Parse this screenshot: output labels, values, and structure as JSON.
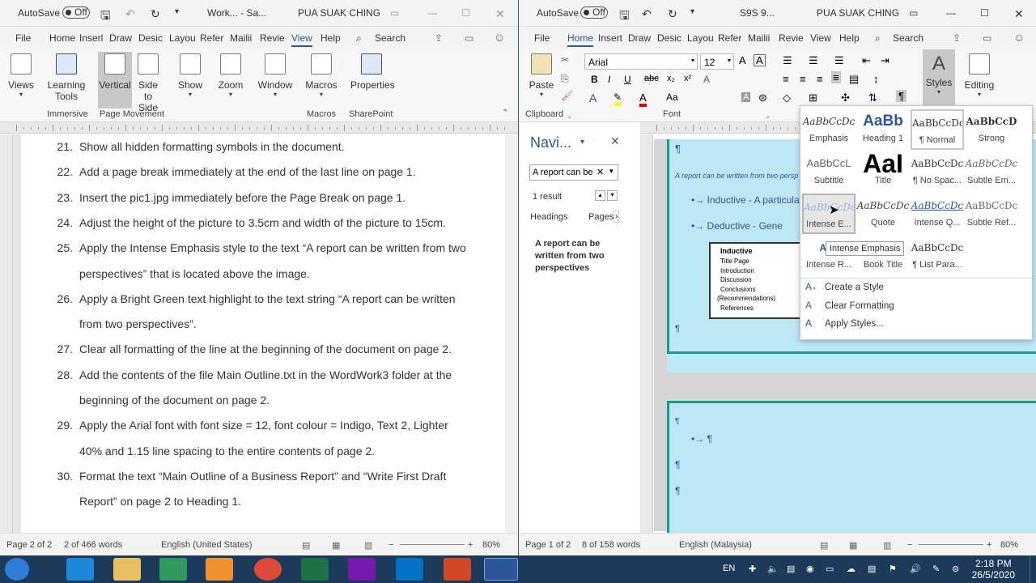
{
  "left": {
    "autosave_label": "AutoSave",
    "autosave_state": "Off",
    "doc_title": "Work... - Sa...",
    "user": "PUA SUAK CHING",
    "tabs": [
      "File",
      "Home",
      "Insert",
      "Draw",
      "Design",
      "Layout",
      "References",
      "Mailings",
      "Review",
      "View",
      "Help"
    ],
    "tabs_short": [
      "File",
      "Home",
      "Inserl",
      "Draw",
      "Desic",
      "Layou",
      "Refer",
      "Mailii",
      "Revie",
      "View",
      "Help"
    ],
    "active_tab": "View",
    "search_label": "Search",
    "ribbon": {
      "views": "Views",
      "learning_tools": "Learning Tools",
      "vertical": "Vertical",
      "side_to_side": "Side to Side",
      "show": "Show",
      "zoom": "Zoom",
      "window": "Window",
      "macros": "Macros",
      "properties": "Properties",
      "group_immersive": "Immersive",
      "group_page_movement": "Page Movement",
      "group_macros": "Macros",
      "group_sharepoint": "SharePoint"
    },
    "lines": [
      {
        "num": "21.",
        "text": "Show all hidden formatting symbols in the document."
      },
      {
        "num": "22.",
        "text": "Add a page break immediately at the end of the last line on page 1."
      },
      {
        "num": "23.",
        "text": "Insert the pic1.jpg immediately before the Page Break on page 1."
      },
      {
        "num": "24.",
        "text": "Adjust the height of the picture to 3.5cm and width of the picture to 15cm."
      },
      {
        "num": "25.",
        "text": "Apply the Intense Emphasis style to the text “A report can be written from two"
      },
      {
        "num": "",
        "text": "perspectives” that is located above the image."
      },
      {
        "num": "26.",
        "text": "Apply a Bright Green text highlight to the text string “A report can be written"
      },
      {
        "num": "",
        "text": "from two perspectives”."
      },
      {
        "num": "27.",
        "text": "Clear all formatting of the line at the beginning of the document on page 2."
      },
      {
        "num": "28.",
        "text": "Add the contents of the file Main Outline.txt in the WordWork3 folder at the"
      },
      {
        "num": "",
        "text": "beginning of the document on page 2."
      },
      {
        "num": "29.",
        "text": "Apply the Arial font with font size = 12, font colour = Indigo, Text 2, Lighter"
      },
      {
        "num": "",
        "text": "40% and 1.15 line spacing to the entire contents of page 2."
      },
      {
        "num": "30.",
        "text": "Format the text “Main Outline of a Business Report” and “Write First Draft"
      },
      {
        "num": "",
        "text": "Report” on page 2 to Heading 1."
      }
    ],
    "status": {
      "page": "Page 2 of 2",
      "words": "2 of 466 words",
      "language": "English (United States)",
      "zoom": "80%"
    }
  },
  "right": {
    "autosave_label": "AutoSave",
    "autosave_state": "Off",
    "doc_title": "S9S 9...",
    "user": "PUA SUAK CHING",
    "tabs_short": [
      "File",
      "Home",
      "Insert",
      "Draw",
      "Desic",
      "Layou",
      "Refer",
      "Mailii",
      "Revie",
      "View",
      "Help"
    ],
    "active_tab": "Home",
    "search_label": "Search",
    "ribbon": {
      "paste": "Paste",
      "font_name": "Arial",
      "font_size": "12",
      "styles": "Styles",
      "editing": "Editing",
      "group_clipboard": "Clipboard",
      "group_font": "Font"
    },
    "nav": {
      "title": "Navi...",
      "search_value": "A report can be",
      "result_count": "1 result",
      "tab_headings": "Headings",
      "tab_pages": "Pages",
      "result_text": "A report can be written from two perspectives"
    },
    "doc": {
      "pilcrow": "¶",
      "emph_text": "A report can be written from two persp",
      "bullet1": "Inductive - A particular",
      "bullet2": "Deductive - Gene",
      "box_title": "Inductive",
      "box_items": [
        "Title Page",
        "Introduction",
        "Discussion",
        "Conclusions",
        "(Recommendations)",
        "References"
      ]
    },
    "styles_gallery": [
      {
        "sample": "AaBbCcDc",
        "name": "Emphasis"
      },
      {
        "sample": "AaBb",
        "name": "Heading 1"
      },
      {
        "sample": "AaBbCcDc",
        "name": "¶ Normal"
      },
      {
        "sample": "AaBbCcD",
        "name": "Strong"
      },
      {
        "sample": "AaBbCcL",
        "name": "Subtitle"
      },
      {
        "sample": "AaI",
        "name": "Title"
      },
      {
        "sample": "AaBbCcDc",
        "name": "¶ No Spac..."
      },
      {
        "sample": "AaBbCcDc",
        "name": "Subtle Em..."
      },
      {
        "sample": "AaBbCcDc",
        "name": "Intense E..."
      },
      {
        "sample": "AaBbCcDc",
        "name": "Quote"
      },
      {
        "sample": "AaBbCcDc",
        "name": "Intense Q..."
      },
      {
        "sample": "AaBbCcDc",
        "name": "Subtle Ref..."
      },
      {
        "sample": "AaE",
        "name": "Intense R..."
      },
      {
        "sample": "",
        "name": "Book Title"
      },
      {
        "sample": "AaBbCcDc",
        "name": "¶ List Para..."
      }
    ],
    "gallery_actions": [
      "Create a Style",
      "Clear Formatting",
      "Apply Styles..."
    ],
    "tooltip": "Intense Emphasis",
    "status": {
      "page": "Page 1 of 2",
      "words": "8 of 158 words",
      "language": "English (Malaysia)",
      "zoom": "80%"
    }
  },
  "taskbar": {
    "lang": "EN",
    "time": "2:18 PM",
    "date": "26/5/2020"
  }
}
